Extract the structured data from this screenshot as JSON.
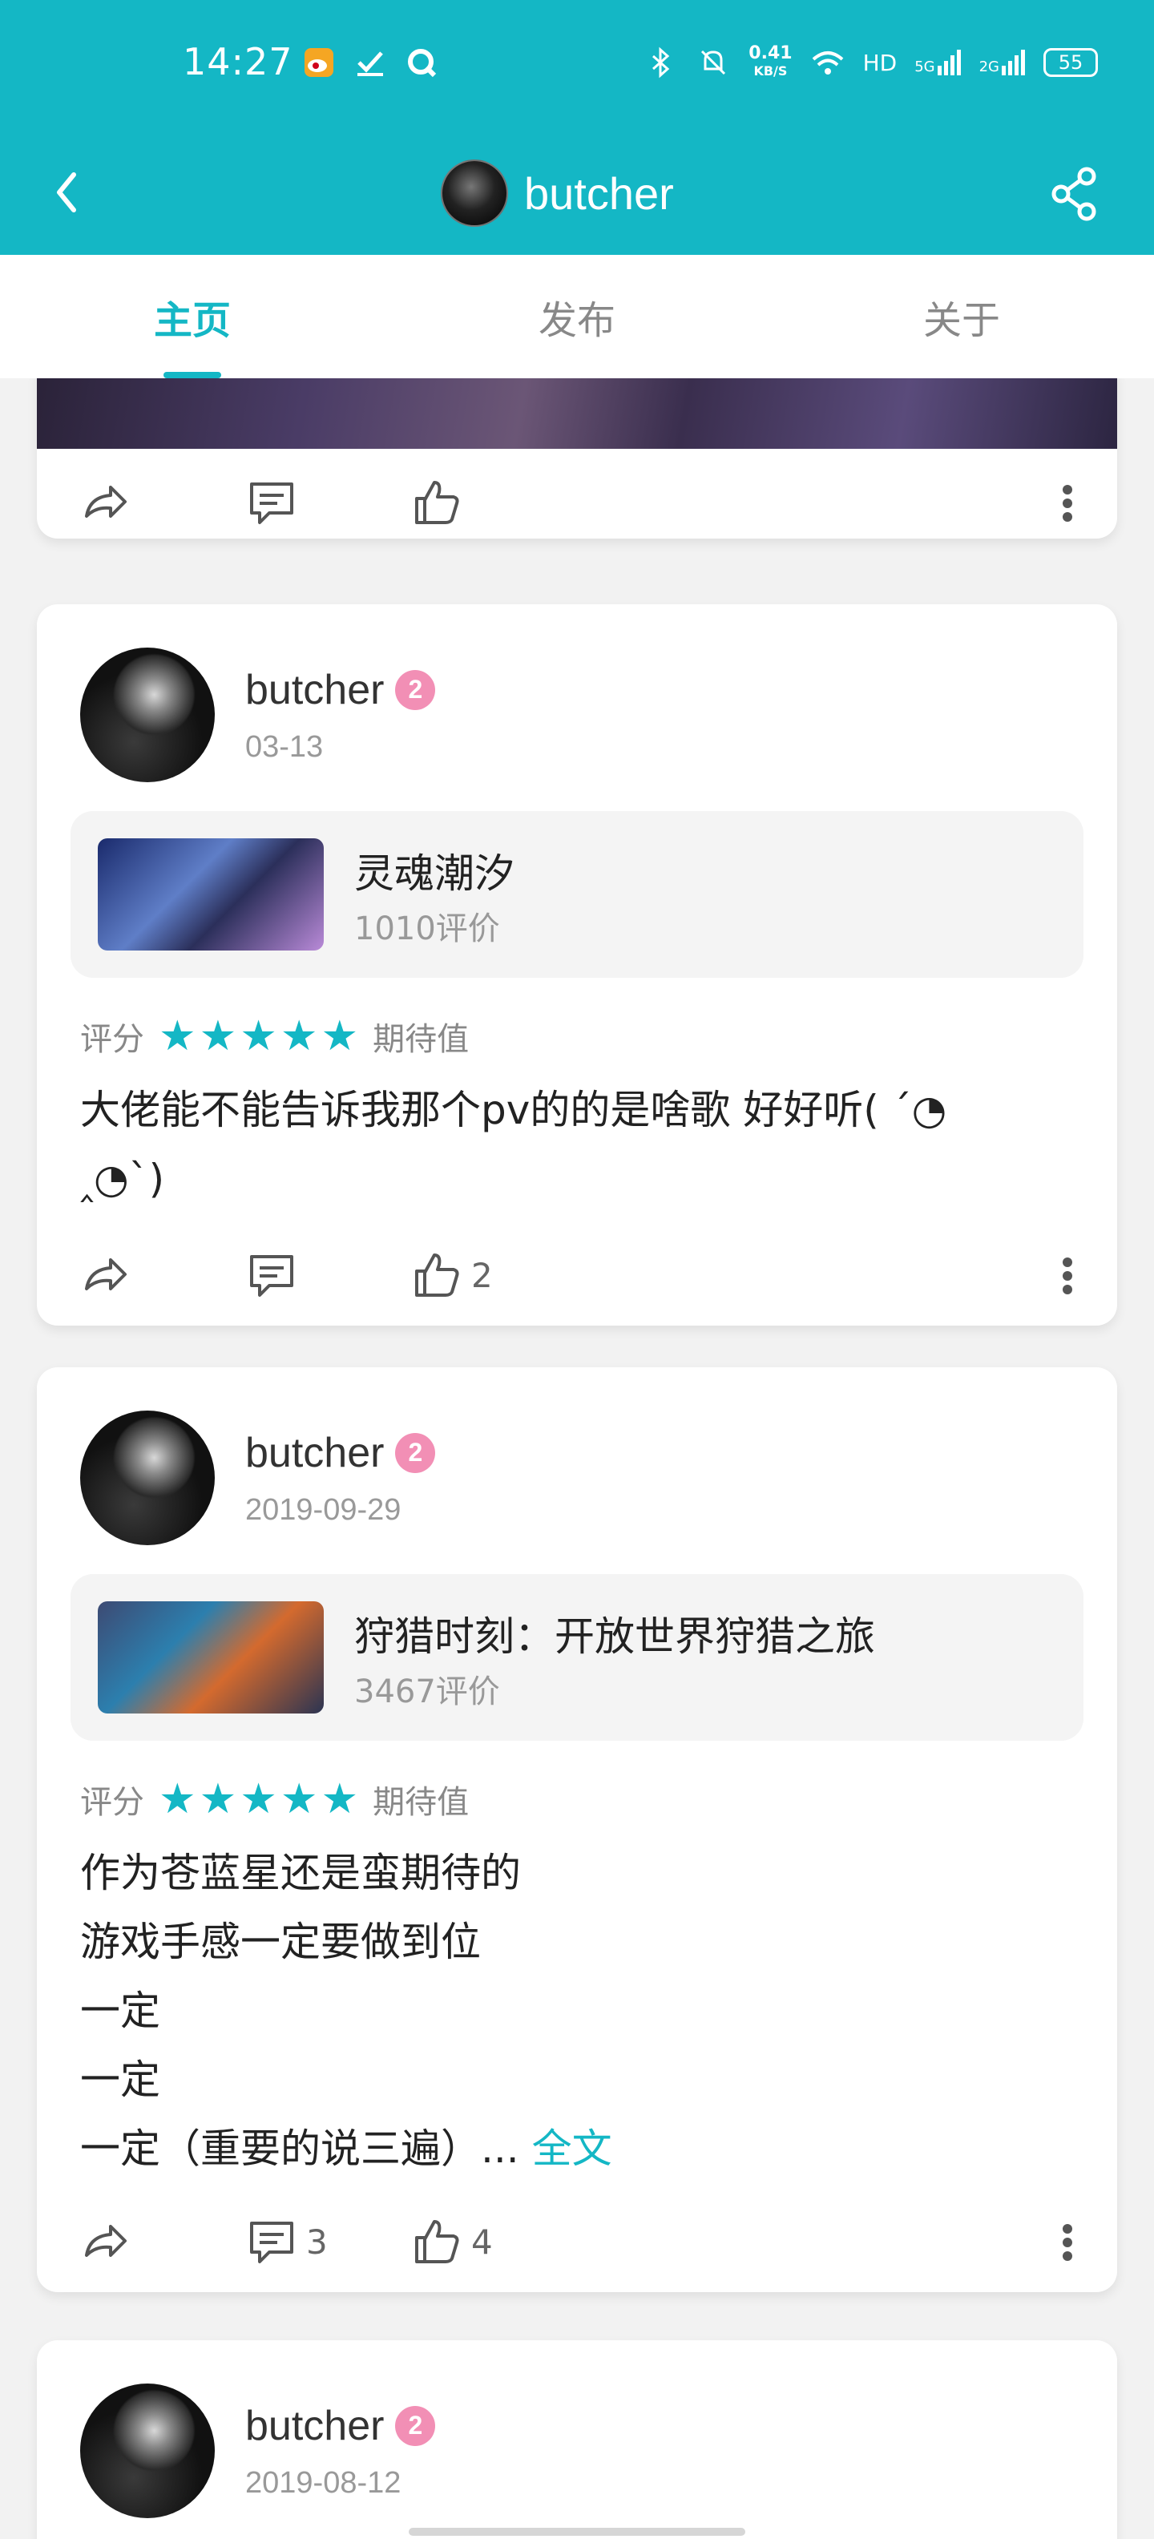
{
  "status": {
    "time": "14:27",
    "speed_value": "0.41",
    "speed_unit": "KB/S",
    "hd": "HD",
    "net1": "5G",
    "net2": "2G",
    "battery": "55",
    "icons": [
      "weibo-icon",
      "check-icon",
      "q-icon",
      "bluetooth-icon",
      "mute-bell-icon",
      "wifi-icon",
      "signal-icon"
    ]
  },
  "appbar": {
    "title": "butcher",
    "back_icon": "chevron-left-icon",
    "share_icon": "share-icon"
  },
  "tabs": [
    {
      "label": "主页",
      "active": true
    },
    {
      "label": "发布",
      "active": false
    },
    {
      "label": "关于",
      "active": false
    }
  ],
  "posts": [
    {
      "partial": true,
      "likes": ""
    },
    {
      "user": "butcher",
      "level": "2",
      "date": "03-13",
      "game_name": "灵魂潮汐",
      "game_reviews": "1010评价",
      "rating_label": "评分",
      "rating_stars": 5,
      "rating_tag": "期待值",
      "text_lines": [
        "大佬能不能告诉我那个pv的的是啥歌 好好听( ´◔",
        "‸◔`)"
      ],
      "comments": "",
      "likes": "2"
    },
    {
      "user": "butcher",
      "level": "2",
      "date": "2019-09-29",
      "game_name": "狩猎时刻：开放世界狩猎之旅",
      "game_reviews": "3467评价",
      "rating_label": "评分",
      "rating_stars": 5,
      "rating_tag": "期待值",
      "text_lines": [
        "作为苍蓝星还是蛮期待的",
        "游戏手感一定要做到位",
        "一定",
        "一定",
        "一定（重要的说三遍）..."
      ],
      "more_link": "全文",
      "comments": "3",
      "likes": "4"
    },
    {
      "user": "butcher",
      "level": "2",
      "date": "2019-08-12"
    }
  ],
  "star_char": "★",
  "accent_color": "#14b7c5"
}
